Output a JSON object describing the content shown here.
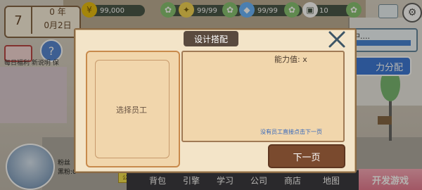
{
  "calendar": {
    "day": "7",
    "year": "0 年",
    "date": "0月2日"
  },
  "stats": [
    {
      "name": "money",
      "value": "99,000",
      "icon": "coin-stack-icon",
      "color": "#e6b800"
    },
    {
      "name": "research",
      "value": "99/99",
      "icon": "lightbulb-icon",
      "color": "#f2d24a"
    },
    {
      "name": "energy",
      "value": "99/99",
      "icon": "gem-icon",
      "color": "#5fb0ff"
    },
    {
      "name": "items",
      "value": "10",
      "icon": "box-icon",
      "color": "#ffffff"
    }
  ],
  "sidebar": {
    "welfare": "每日福利 新说明 保"
  },
  "background_panels": {
    "dev_status": "发中....",
    "assign_button": "力分配"
  },
  "player": {
    "fans": "粉丝",
    "black_fans": "黑粉:0",
    "public_tag": "公关"
  },
  "bottom_menu": [
    "背包",
    "引擎",
    "学习",
    "公司",
    "商店",
    "地图"
  ],
  "develop_game": "开发游戏",
  "modal": {
    "title": "设计搭配",
    "select_employee": "选择员工",
    "ability": "能力值: x",
    "hint": "没有员工直接点击下一页",
    "next": "下一页"
  },
  "colors": {
    "modal_bg": "#f3e4c8",
    "panel_bg": "#f1d6ac",
    "button_brown": "#7a4a2e",
    "accent_blue": "#2f6fd6"
  }
}
